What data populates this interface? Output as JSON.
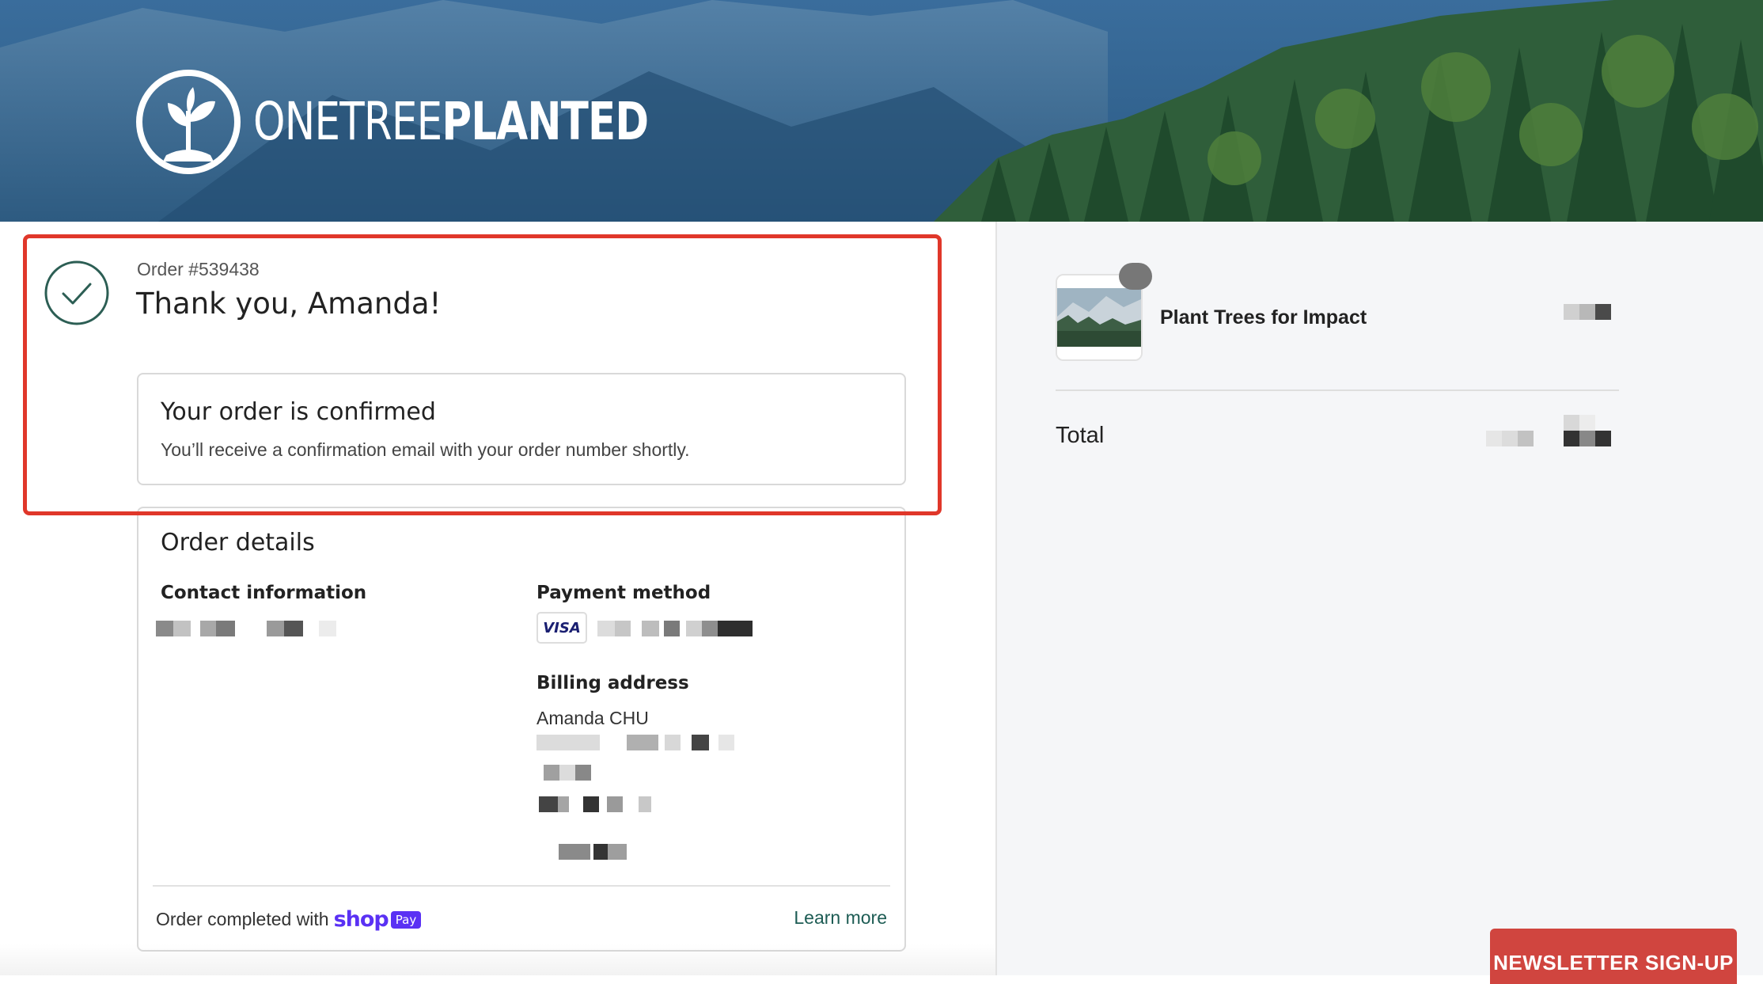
{
  "brand": {
    "logo_text_bold": "ONETREE",
    "logo_text_light": "PLANTED"
  },
  "order": {
    "number_label": "Order #539438",
    "thank_you": "Thank you, Amanda!"
  },
  "confirmation": {
    "title": "Your order is confirmed",
    "message": "You’ll receive a confirmation email with your order number shortly."
  },
  "details": {
    "title": "Order details",
    "contact_heading": "Contact information",
    "payment_heading": "Payment method",
    "card_brand": "VISA",
    "billing_heading": "Billing address",
    "billing_name": "Amanda CHU"
  },
  "footer": {
    "completed_with": "Order completed with",
    "shop_logo": "shop",
    "pay_badge": "Pay",
    "learn_more": "Learn more"
  },
  "summary": {
    "product_name": "Plant Trees for Impact",
    "total_label": "Total"
  },
  "newsletter": {
    "label": "NEWSLETTER SIGN-UP"
  },
  "colors": {
    "highlight": "#e0372a",
    "accent_green": "#1d5c54",
    "shop_purple": "#5a31f4",
    "newsletter_red": "#d0453f"
  }
}
